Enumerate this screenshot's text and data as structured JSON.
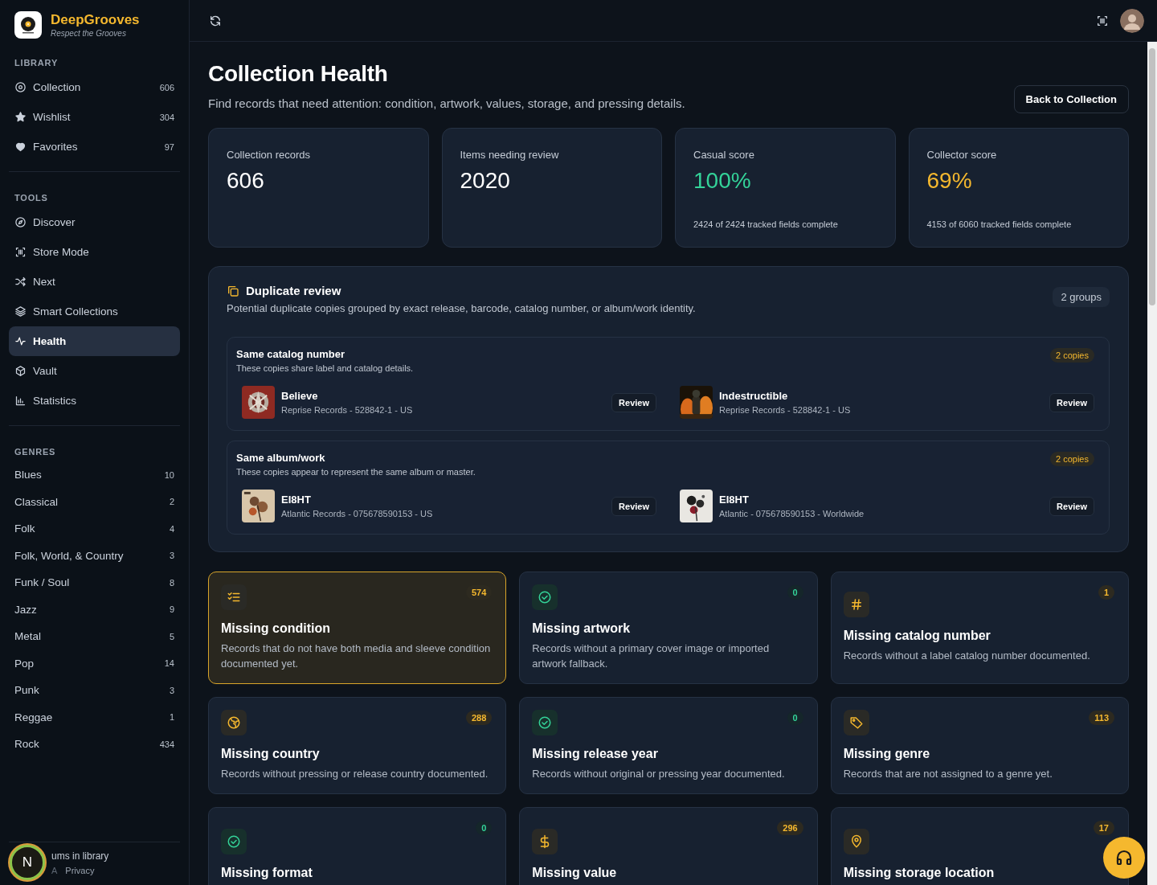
{
  "brand": {
    "name": "DeepGrooves",
    "tagline": "Respect the Grooves"
  },
  "sidebar": {
    "sections": [
      {
        "heading": "LIBRARY",
        "items": [
          {
            "label": "Collection",
            "count": "606",
            "selected": false
          },
          {
            "label": "Wishlist",
            "count": "304",
            "selected": false
          },
          {
            "label": "Favorites",
            "count": "97",
            "selected": false
          }
        ]
      },
      {
        "heading": "TOOLS",
        "items": [
          {
            "label": "Discover",
            "selected": false
          },
          {
            "label": "Store Mode",
            "selected": false
          },
          {
            "label": "Next",
            "selected": false
          },
          {
            "label": "Smart Collections",
            "selected": false
          },
          {
            "label": "Health",
            "selected": true
          },
          {
            "label": "Vault",
            "selected": false
          },
          {
            "label": "Statistics",
            "selected": false
          }
        ]
      },
      {
        "heading": "GENRES",
        "items": [
          {
            "label": "Blues",
            "count": "10",
            "selected": false
          },
          {
            "label": "Classical",
            "count": "2",
            "selected": false
          },
          {
            "label": "Folk",
            "count": "4",
            "selected": false
          },
          {
            "label": "Folk, World, & Country",
            "count": "3",
            "selected": false
          },
          {
            "label": "Funk / Soul",
            "count": "8",
            "selected": false
          },
          {
            "label": "Jazz",
            "count": "9",
            "selected": false
          },
          {
            "label": "Metal",
            "count": "5",
            "selected": false
          },
          {
            "label": "Pop",
            "count": "14",
            "selected": false
          },
          {
            "label": "Punk",
            "count": "3",
            "selected": false
          },
          {
            "label": "Reggae",
            "count": "1",
            "selected": false
          },
          {
            "label": "Rock",
            "count": "434",
            "selected": false
          }
        ]
      }
    ],
    "footer": {
      "avatar": "N",
      "summary": "ums in library",
      "links": [
        "A",
        "Privacy"
      ]
    }
  },
  "page": {
    "title": "Collection Health",
    "subtitle": "Find records that need attention: condition, artwork, values, storage, and pressing details.",
    "back_button": "Back to Collection"
  },
  "stats": [
    {
      "label": "Collection records",
      "value": "606",
      "kind": "plain"
    },
    {
      "label": "Items needing review",
      "value": "2020",
      "kind": "plain"
    },
    {
      "label": "Casual score",
      "value": "100%",
      "note": "2424 of 2424 tracked fields complete",
      "kind": "good"
    },
    {
      "label": "Collector score",
      "value": "69%",
      "note": "4153 of 6060 tracked fields complete",
      "kind": "warn"
    }
  ],
  "duplicates": {
    "title": "Duplicate review",
    "description": "Potential duplicate copies grouped by exact release, barcode, catalog number, or album/work identity.",
    "count": "2 groups",
    "groups": [
      {
        "title": "Same catalog number",
        "description": "These copies share label and catalog details.",
        "badge": "2 copies",
        "records": [
          {
            "title": "Believe",
            "details": "Reprise Records - 528842-1 - US",
            "action": "Review"
          },
          {
            "title": "Indestructible",
            "details": "Reprise Records - 528842-1 - US",
            "action": "Review"
          }
        ]
      },
      {
        "title": "Same album/work",
        "description": "These copies appear to represent the same album or master.",
        "badge": "2 copies",
        "records": [
          {
            "title": "EI8HT",
            "details": "Atlantic Records - 075678590153 - US",
            "action": "Review"
          },
          {
            "title": "EI8HT",
            "details": "Atlantic - 075678590153 - Worldwide",
            "action": "Review"
          }
        ]
      }
    ]
  },
  "issues": [
    {
      "kind": "condition",
      "title": "Missing condition",
      "description": "Records that do not have both media and sleeve condition documented yet.",
      "count": "574",
      "resolved": false,
      "selected": true
    },
    {
      "title": "Missing artwork",
      "description": "Records without a primary cover image or imported artwork fallback.",
      "count": "0",
      "resolved": true,
      "selected": false
    },
    {
      "kind": "catalog",
      "title": "Missing catalog number",
      "description": "Records without a label catalog number documented.",
      "count": "1",
      "resolved": false,
      "selected": false
    },
    {
      "kind": "country",
      "title": "Missing country",
      "description": "Records without pressing or release country documented.",
      "count": "288",
      "resolved": false,
      "selected": false
    },
    {
      "title": "Missing release year",
      "description": "Records without original or pressing year documented.",
      "count": "0",
      "resolved": true,
      "selected": false
    },
    {
      "kind": "genre",
      "title": "Missing genre",
      "description": "Records that are not assigned to a genre yet.",
      "count": "113",
      "resolved": false,
      "selected": false
    },
    {
      "title": "Missing format",
      "count": "0",
      "resolved": true,
      "selected": false
    },
    {
      "kind": "value",
      "title": "Missing value",
      "count": "296",
      "resolved": false,
      "selected": false
    },
    {
      "kind": "storage",
      "title": "Missing storage location",
      "count": "17",
      "resolved": false,
      "selected": false
    }
  ]
}
